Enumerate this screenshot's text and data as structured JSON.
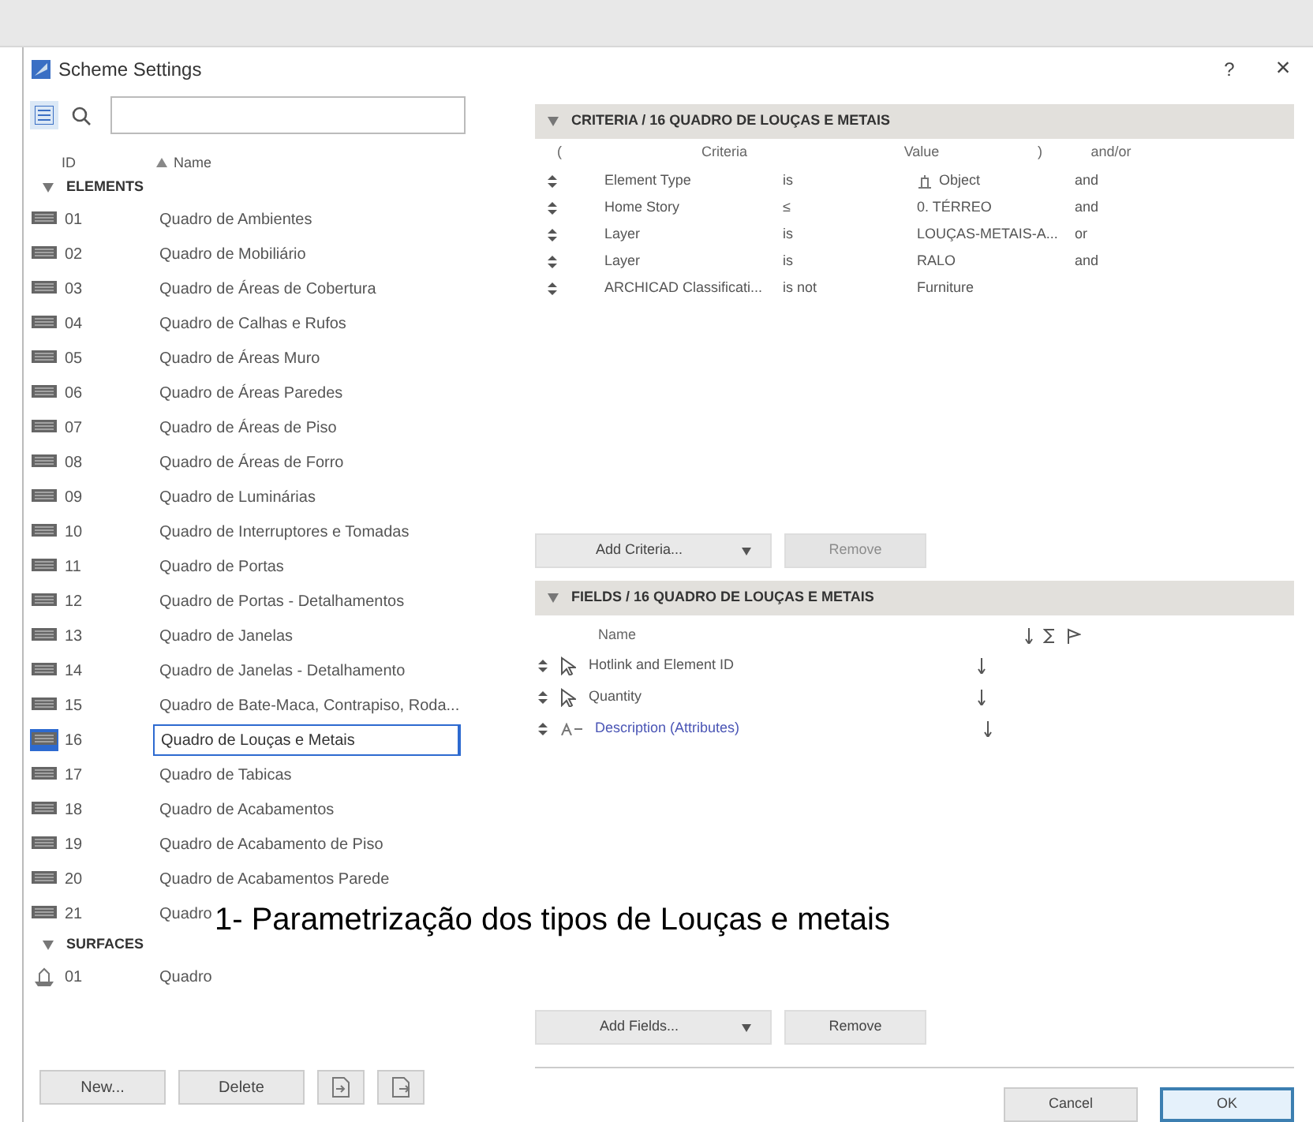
{
  "window": {
    "title": "Scheme Settings",
    "help": "?",
    "close": "×"
  },
  "tree": {
    "columns": [
      "ID",
      "Name"
    ],
    "groups": [
      {
        "label": "ELEMENTS",
        "expanded": true,
        "kind": "table",
        "items": [
          {
            "id": "01",
            "name": "Quadro de Ambientes",
            "selected": false
          },
          {
            "id": "02",
            "name": "Quadro de Mobiliário",
            "selected": false
          },
          {
            "id": "03",
            "name": "Quadro de Áreas de Cobertura",
            "selected": false
          },
          {
            "id": "04",
            "name": "Quadro de Calhas e Rufos",
            "selected": false
          },
          {
            "id": "05",
            "name": "Quadro de Áreas Muro",
            "selected": false
          },
          {
            "id": "06",
            "name": "Quadro de Áreas Paredes",
            "selected": false
          },
          {
            "id": "07",
            "name": "Quadro de Áreas de Piso",
            "selected": false
          },
          {
            "id": "08",
            "name": "Quadro de Áreas de Forro",
            "selected": false
          },
          {
            "id": "09",
            "name": "Quadro de Luminárias",
            "selected": false
          },
          {
            "id": "10",
            "name": "Quadro de Interruptores e Tomadas",
            "selected": false
          },
          {
            "id": "11",
            "name": "Quadro de Portas",
            "selected": false
          },
          {
            "id": "12",
            "name": "Quadro de Portas - Detalhamentos",
            "selected": false
          },
          {
            "id": "13",
            "name": "Quadro de Janelas",
            "selected": false
          },
          {
            "id": "14",
            "name": "Quadro de Janelas - Detalhamento",
            "selected": false
          },
          {
            "id": "15",
            "name": "Quadro de Bate-Maca, Contrapiso, Roda...",
            "selected": false
          },
          {
            "id": "16",
            "name": "Quadro de Louças e Metais",
            "selected": true
          },
          {
            "id": "17",
            "name": "Quadro de Tabicas",
            "selected": false
          },
          {
            "id": "18",
            "name": "Quadro de Acabamentos",
            "selected": false
          },
          {
            "id": "19",
            "name": "Quadro de Acabamento de Piso",
            "selected": false
          },
          {
            "id": "20",
            "name": "Quadro de Acabamentos Parede",
            "selected": false
          },
          {
            "id": "21",
            "name": "Quadro",
            "selected": false
          }
        ]
      },
      {
        "label": "SURFACES",
        "expanded": true,
        "kind": "surface",
        "items": [
          {
            "id": "01",
            "name": "Quadro",
            "selected": false
          }
        ]
      }
    ]
  },
  "left_buttons": [
    {
      "kind": "text",
      "label": "New..."
    },
    {
      "kind": "text",
      "label": "Delete"
    },
    {
      "kind": "import"
    },
    {
      "kind": "export"
    }
  ],
  "criteria": {
    "title": "CRITERIA / 16 QUADRO DE LOUÇAS E METAIS",
    "expanded": true,
    "columns": [
      "(",
      "Criteria",
      "Value",
      ")",
      "and/or"
    ],
    "rows": [
      {
        "criterion": "Element Type",
        "operator": "is",
        "value": "Object",
        "value_icon": true,
        "conj": "and"
      },
      {
        "criterion": "Home Story",
        "operator": "≤",
        "value": "0. TÉRREO",
        "value_icon": false,
        "conj": "and"
      },
      {
        "criterion": "Layer",
        "operator": "is",
        "value": "LOUÇAS-METAIS-A...",
        "value_icon": false,
        "conj": "or"
      },
      {
        "criterion": "Layer",
        "operator": "is",
        "value": "RALO",
        "value_icon": false,
        "conj": "and"
      },
      {
        "criterion": "ARCHICAD Classificati...",
        "operator": "is not",
        "value": "Furniture",
        "value_icon": false,
        "conj": ""
      }
    ],
    "add_button": "Add Criteria...",
    "remove_button": {
      "label": "Remove",
      "disabled": true
    }
  },
  "fields": {
    "title": "FIELDS / 16 QUADRO DE LOUÇAS E METAIS",
    "expanded": true,
    "column": "Name",
    "rows": [
      {
        "name": "Hotlink and Element ID",
        "kind": "element"
      },
      {
        "name": "Quantity",
        "kind": "element"
      },
      {
        "name": "Description (Attributes)",
        "kind": "attribute"
      }
    ],
    "add_button": "Add Fields...",
    "remove_button": {
      "label": "Remove",
      "disabled": false
    }
  },
  "caption": "1- Parametrização dos tipos de Louças e metais",
  "buttons": [
    {
      "label": "Cancel",
      "default": false
    },
    {
      "label": "OK",
      "default": true
    }
  ]
}
